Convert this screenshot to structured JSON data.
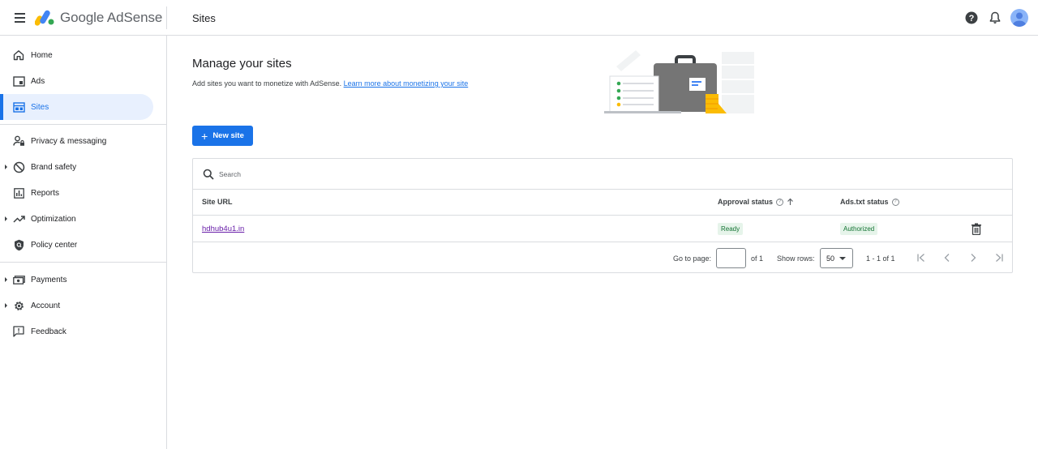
{
  "header": {
    "brand_google": "Google",
    "brand_product": "AdSense",
    "page_title": "Sites",
    "icons": [
      "menu-icon",
      "help-icon",
      "bell-icon",
      "avatar"
    ]
  },
  "sidebar": {
    "items": [
      {
        "label": "Home",
        "icon": "home-icon"
      },
      {
        "label": "Ads",
        "icon": "ads-icon"
      },
      {
        "label": "Sites",
        "icon": "sites-icon",
        "active": true
      },
      {
        "label": "Privacy & messaging",
        "icon": "privacy-icon"
      },
      {
        "label": "Brand safety",
        "icon": "block-icon"
      },
      {
        "label": "Reports",
        "icon": "reports-icon"
      },
      {
        "label": "Optimization",
        "icon": "trending-icon"
      },
      {
        "label": "Policy center",
        "icon": "shield-icon"
      },
      {
        "label": "Payments",
        "icon": "payments-icon"
      },
      {
        "label": "Account",
        "icon": "gear-icon"
      },
      {
        "label": "Feedback",
        "icon": "feedback-icon"
      }
    ]
  },
  "main": {
    "title": "Manage your sites",
    "subtitle": "Add sites you want to monetize with AdSense.",
    "learn_more": "Learn more about monetizing your site",
    "new_site_label": "New site",
    "search_placeholder": "Search",
    "columns": {
      "site_url": "Site URL",
      "approval": "Approval status",
      "adstxt": "Ads.txt status"
    },
    "rows": [
      {
        "site": "hdhub4u1.in",
        "approval": "Ready",
        "adstxt": "Authorized"
      }
    ],
    "pager": {
      "goto_label": "Go to page:",
      "page_value": "",
      "of_label": "of 1",
      "rows_label": "Show rows:",
      "rows_value": "50",
      "range": "1 - 1 of 1"
    }
  },
  "colors": {
    "accent": "#1a73e8",
    "active_bg": "#e8f0fe",
    "badge_bg": "#e6f4ea",
    "badge_text": "#137333",
    "visited_link": "#681da8"
  }
}
